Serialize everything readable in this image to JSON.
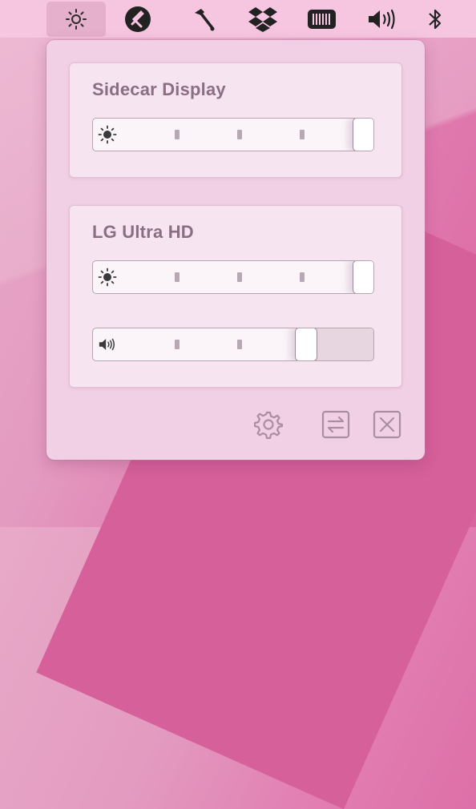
{
  "menubar": {
    "items": [
      {
        "icon": "brightness-icon",
        "active": true
      },
      {
        "icon": "teamviewer-icon"
      },
      {
        "icon": "hammer-icon"
      },
      {
        "icon": "dropbox-icon"
      },
      {
        "icon": "battery-icon"
      },
      {
        "icon": "volume-icon"
      },
      {
        "icon": "bluetooth-icon"
      }
    ]
  },
  "displays": [
    {
      "name": "Sidecar Display",
      "brightness": 1.0
    },
    {
      "name": "LG Ultra HD",
      "brightness": 1.0,
      "volume": 0.75
    }
  ],
  "footer": {
    "icons": [
      "settings-icon",
      "swap-display-icon",
      "close-icon"
    ]
  },
  "colors": {
    "accent": "#f6c6e0",
    "popover": "#f1cfe4",
    "card": "#f7e4f1",
    "title": "#8a6f82"
  }
}
